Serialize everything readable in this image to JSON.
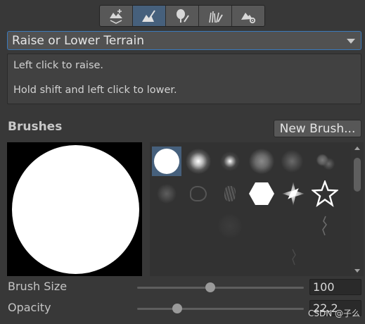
{
  "toolbar": {
    "buttons": [
      {
        "name": "create-neighbor-terrains-icon",
        "active": false
      },
      {
        "name": "paint-terrain-icon",
        "active": true
      },
      {
        "name": "paint-trees-icon",
        "active": false
      },
      {
        "name": "paint-details-icon",
        "active": false
      },
      {
        "name": "terrain-settings-icon",
        "active": false
      }
    ]
  },
  "tool_dropdown": {
    "selected": "Raise or Lower Terrain"
  },
  "help": {
    "line1": "Left click to raise.",
    "line2": "Hold shift and left click to lower."
  },
  "brushes": {
    "title": "Brushes",
    "new_brush_label": "New Brush...",
    "items": [
      {
        "name": "brush-hard-circle",
        "selected": true
      },
      {
        "name": "brush-soft-circle"
      },
      {
        "name": "brush-small-soft-circle"
      },
      {
        "name": "brush-noise-cloud"
      },
      {
        "name": "brush-noise-patch"
      },
      {
        "name": "brush-splatter"
      },
      {
        "name": "brush-noise-small"
      },
      {
        "name": "brush-swirl"
      },
      {
        "name": "brush-streak"
      },
      {
        "name": "brush-hexagon"
      },
      {
        "name": "brush-star-burst"
      },
      {
        "name": "brush-star-outline"
      },
      {
        "name": "brush-faint-texture"
      },
      {
        "name": "brush-crack"
      },
      {
        "name": "brush-faint-crack"
      }
    ]
  },
  "params": {
    "brush_size": {
      "label": "Brush Size",
      "value": "100",
      "fraction": 0.44
    },
    "opacity": {
      "label": "Opacity",
      "value": "22.2",
      "fraction": 0.24
    }
  },
  "watermark": "CSDN @子么"
}
